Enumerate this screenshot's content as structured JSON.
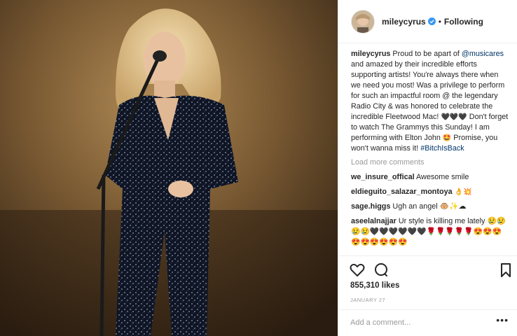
{
  "header": {
    "username": "mileycyrus",
    "separator": "•",
    "follow_status": "Following"
  },
  "caption": {
    "username": "mileycyrus",
    "text_before": "Proud to be apart of",
    "mention": "@musicares",
    "text_mid": "and amazed by their incredible efforts supporting artists! You're always there when we need you most! Was a privilege to perform for such an impactful room @ the legendary Radio City & was honored to celebrate the incredible Fleetwood Mac!",
    "hearts": "🖤🖤🖤",
    "text_after": "Don't forget to watch The Grammys this Sunday! I am performing with Elton John",
    "emoji_grin": "🤩",
    "text_end": "Promise, you won't wanna miss it!",
    "hashtag": "#BitchIsBack"
  },
  "load_more": "Load more comments",
  "comments": [
    {
      "username": "we_insure_offical",
      "text": "Awesome smile"
    },
    {
      "username": "eldieguito_salazar_montoya",
      "text": "👌💥"
    },
    {
      "username": "sage.higgs",
      "text": "Ugh an angel 🐵✨☁"
    },
    {
      "username": "aseelalnajjar",
      "text": "Ur style is killing me lately 😢😢😢😢🖤🖤🖤🖤🖤🖤🌹🌹🌹🌹🌹😍😍😍😍😍😍😍😍😍"
    }
  ],
  "likes": "855,310 likes",
  "date": "JANUARY 27",
  "add_comment_placeholder": "Add a comment...",
  "more_options": "•••",
  "icons": {
    "like": "heart-outline-icon",
    "comment": "comment-bubble-icon",
    "save": "bookmark-icon",
    "verified": "verified-badge-icon"
  },
  "colors": {
    "verified": "#3897f0",
    "link": "#003569",
    "muted": "#999999",
    "text": "#262626"
  }
}
